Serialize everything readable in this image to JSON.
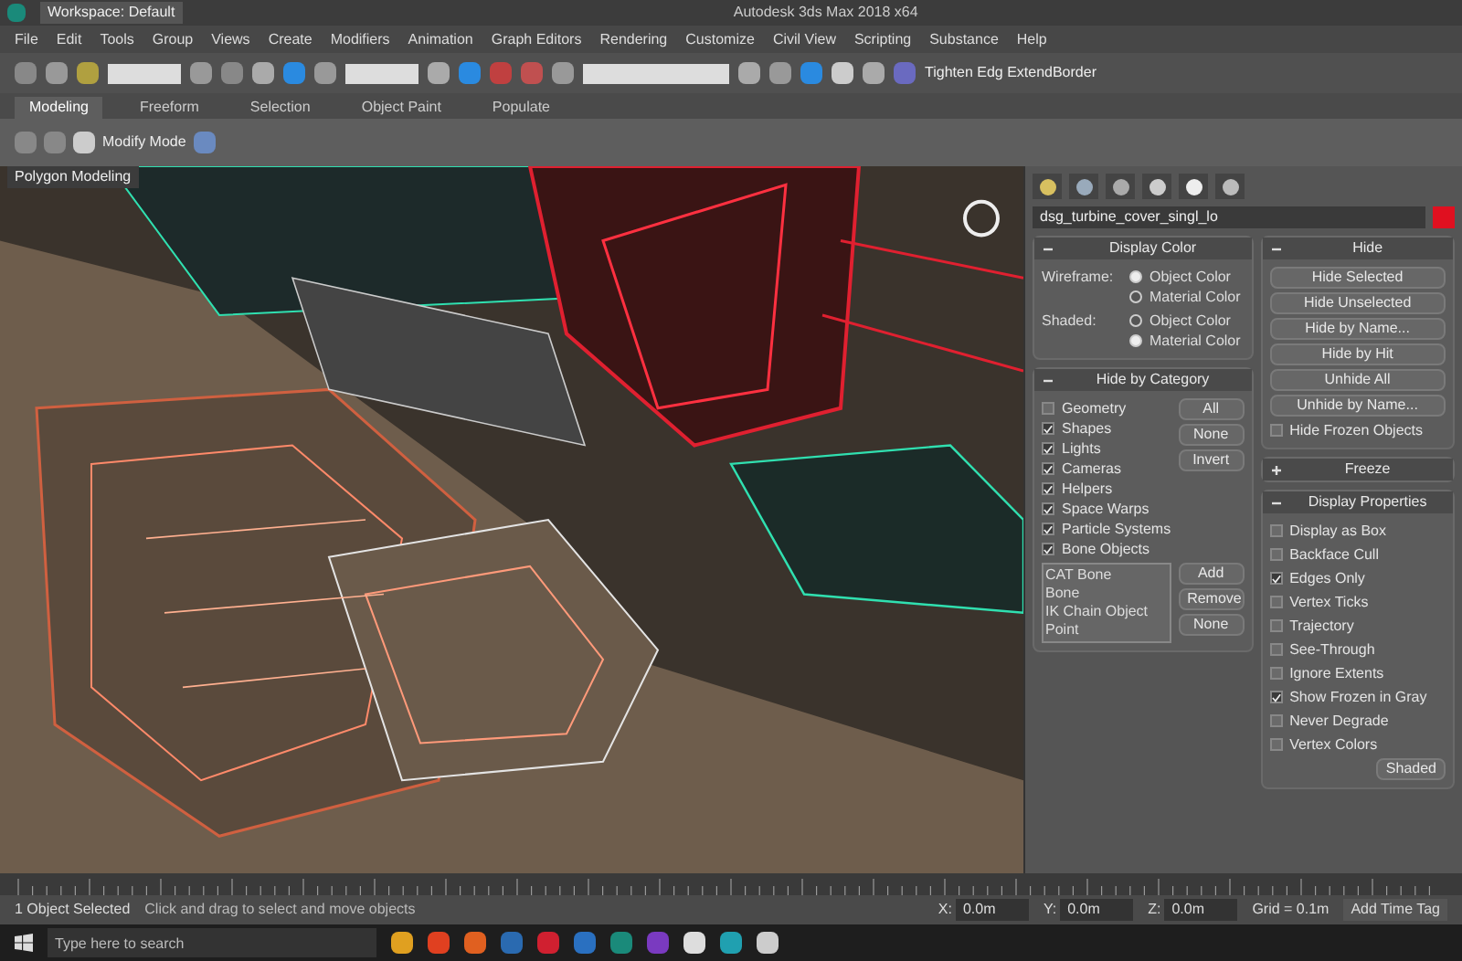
{
  "title_bar": {
    "workspace": "Workspace: Default",
    "title": "Autodesk 3ds Max 2018 x64"
  },
  "menu": [
    "File",
    "Edit",
    "Tools",
    "Group",
    "Views",
    "Create",
    "Modifiers",
    "Animation",
    "Graph Editors",
    "Rendering",
    "Customize",
    "Civil View",
    "Scripting",
    "Substance",
    "Help"
  ],
  "toolbar": {
    "extension_label": "Tighten Edg ExtendBorder"
  },
  "ribbon": {
    "tabs": [
      {
        "label": "Modeling",
        "selected": true
      },
      {
        "label": "Freeform",
        "selected": false
      },
      {
        "label": "Selection",
        "selected": false
      },
      {
        "label": "Object Paint",
        "selected": false
      },
      {
        "label": "Populate",
        "selected": false
      }
    ],
    "panel_label": "Modify Mode",
    "group_label": "Polygon Modeling"
  },
  "command_panel": {
    "object_name": "dsg_turbine_cover_singl_lo",
    "display_color": {
      "title": "Display Color",
      "expanded": true,
      "groups": [
        {
          "label": "Wireframe:",
          "options": [
            {
              "label": "Object Color",
              "selected": true
            },
            {
              "label": "Material Color",
              "selected": false
            }
          ]
        },
        {
          "label": "Shaded:",
          "options": [
            {
              "label": "Object Color",
              "selected": false
            },
            {
              "label": "Material Color",
              "selected": true
            }
          ]
        }
      ]
    },
    "hide_by_category": {
      "title": "Hide by Category",
      "expanded": true,
      "items": [
        {
          "label": "Geometry",
          "checked": false
        },
        {
          "label": "Shapes",
          "checked": true
        },
        {
          "label": "Lights",
          "checked": true
        },
        {
          "label": "Cameras",
          "checked": true
        },
        {
          "label": "Helpers",
          "checked": true
        },
        {
          "label": "Space Warps",
          "checked": true
        },
        {
          "label": "Particle Systems",
          "checked": true
        },
        {
          "label": "Bone Objects",
          "checked": true
        }
      ],
      "buttons": [
        "All",
        "None",
        "Invert"
      ],
      "list": [
        "CAT Bone",
        "Bone",
        "IK Chain Object",
        "Point"
      ],
      "list_buttons": [
        "Add",
        "Remove",
        "None"
      ]
    },
    "hide": {
      "title": "Hide",
      "expanded": true,
      "buttons": [
        "Hide Selected",
        "Hide Unselected",
        "Hide by Name...",
        "Hide by Hit",
        "Unhide All",
        "Unhide by Name..."
      ],
      "checkbox": {
        "label": "Hide Frozen Objects",
        "checked": false
      }
    },
    "freeze": {
      "title": "Freeze",
      "expanded": false
    },
    "display_properties": {
      "title": "Display Properties",
      "expanded": true,
      "items": [
        {
          "label": "Display as Box",
          "checked": false
        },
        {
          "label": "Backface Cull",
          "checked": false
        },
        {
          "label": "Edges Only",
          "checked": true
        },
        {
          "label": "Vertex Ticks",
          "checked": false
        },
        {
          "label": "Trajectory",
          "checked": false
        },
        {
          "label": "See-Through",
          "checked": false
        },
        {
          "label": "Ignore Extents",
          "checked": false
        },
        {
          "label": "Show Frozen in Gray",
          "checked": true
        },
        {
          "label": "Never Degrade",
          "checked": false
        },
        {
          "label": "Vertex Colors",
          "checked": false
        }
      ],
      "button": "Shaded"
    }
  },
  "status_bar": {
    "selection": "1 Object Selected",
    "prompt": "Click and drag to select and move objects",
    "coords": [
      {
        "axis": "X:",
        "value": "0.0m"
      },
      {
        "axis": "Y:",
        "value": "0.0m"
      },
      {
        "axis": "Z:",
        "value": "0.0m"
      }
    ],
    "grid": "Grid = 0.1m",
    "time_tag": "Add Time Tag"
  },
  "taskbar": {
    "search_placeholder": "Type here to search"
  }
}
